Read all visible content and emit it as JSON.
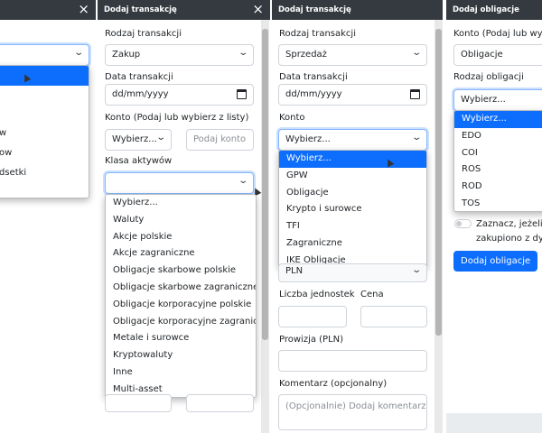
{
  "panel1": {
    "close": "×",
    "options": [
      "",
      "",
      "",
      "w",
      "ow",
      "dsetki"
    ]
  },
  "panel2": {
    "title": "Dodaj transakcję",
    "close": "×",
    "type_label": "Rodzaj transakcji",
    "type_value": "Zakup",
    "date_label": "Data transakcji",
    "date_value": "dd/mm/yyyy",
    "account_label": "Konto (Podaj lub wybierz z listy)",
    "account_value": "Wybierz...",
    "account_placeholder": "Podaj konto",
    "class_label": "Klasa aktywów",
    "class_options": [
      "Wybierz...",
      "Waluty",
      "Akcje polskie",
      "Akcje zagraniczne",
      "Obligacje skarbowe polskie",
      "Obligacje skarbowe zagraniczne",
      "Obligacje korporacyjne polskie",
      "Obligacje korporacyjne zagraniczne",
      "Metale i surowce",
      "Kryptowaluty",
      "Inne",
      "Multi-asset"
    ]
  },
  "panel3": {
    "title": "Dodaj transakcję",
    "type_label": "Rodzaj transakcji",
    "type_value": "Sprzedaż",
    "date_label": "Data transakcji",
    "date_value": "dd/mm/yyyy",
    "account_label": "Konto",
    "account_value": "Wybierz...",
    "account_options": [
      "Wybierz...",
      "GPW",
      "Obligacje",
      "Krypto i surowce",
      "TFI",
      "Zagraniczne",
      "IKE Obligacje"
    ],
    "currency_value": "PLN",
    "units_label": "Liczba jednostek",
    "price_label": "Cena",
    "commission_label": "Prowizja (PLN)",
    "comment_label": "Komentarz (opcjonalny)",
    "comment_placeholder": "(Opcjonalnie) Dodaj komentarz"
  },
  "panel4": {
    "title": "Dodaj obligacje",
    "account_label": "Konto (Podaj lub wybi",
    "account_value": "Obligacje",
    "type_label": "Rodzaj obligacji",
    "type_value": "Wybierz...",
    "type_options": [
      "Wybierz...",
      "EDO",
      "COI",
      "ROS",
      "ROD",
      "TOS"
    ],
    "checkbox_label_1": "Zaznacz, jeżeli o",
    "checkbox_label_2": "zakupiono z dys",
    "submit": "Dodaj obligacje"
  }
}
